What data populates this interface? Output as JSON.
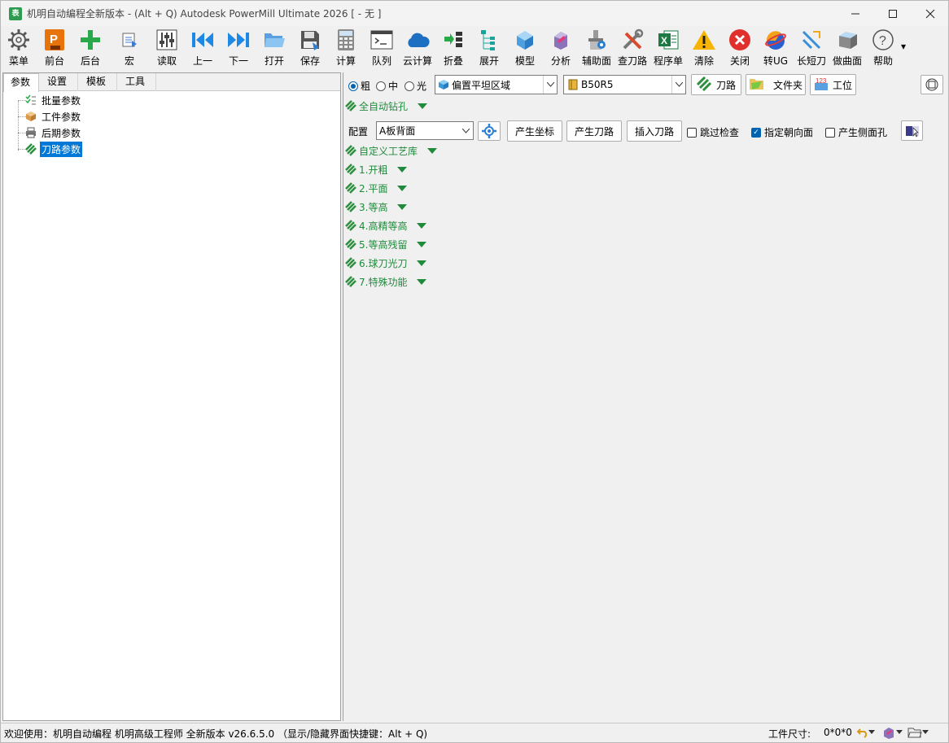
{
  "window": {
    "title": "机明自动编程全新版本 - (Alt + Q) Autodesk PowerMill Ultimate 2026   [ - 无 ]",
    "app_icon": "表",
    "controls": [
      "—",
      "☐",
      "✕"
    ]
  },
  "toolbar": {
    "items": [
      {
        "label": "菜单",
        "icon": "gear-icon"
      },
      {
        "label": "前台",
        "icon": "powermill-icon"
      },
      {
        "label": "后台",
        "icon": "plus-icon"
      },
      {
        "label": "宏",
        "icon": "macro-icon"
      },
      {
        "label": "读取",
        "icon": "sliders-icon"
      },
      {
        "label": "上一",
        "icon": "prev-icon"
      },
      {
        "label": "下一",
        "icon": "next-icon"
      },
      {
        "label": "打开",
        "icon": "folder-icon"
      },
      {
        "label": "保存",
        "icon": "save-icon"
      },
      {
        "label": "计算",
        "icon": "calculator-icon"
      },
      {
        "label": "队列",
        "icon": "terminal-icon"
      },
      {
        "label": "云计算",
        "icon": "cloud-icon"
      },
      {
        "label": "折叠",
        "icon": "collapse-icon"
      },
      {
        "label": "展开",
        "icon": "expand-icon"
      },
      {
        "label": "模型",
        "icon": "cube-icon"
      },
      {
        "label": "分析",
        "icon": "analysis-icon"
      },
      {
        "label": "辅助面",
        "icon": "aux-surface-icon"
      },
      {
        "label": "查刀路",
        "icon": "tools-icon"
      },
      {
        "label": "程序单",
        "icon": "excel-icon"
      },
      {
        "label": "清除",
        "icon": "warning-icon"
      },
      {
        "label": "关闭",
        "icon": "close-icon"
      },
      {
        "label": "转UG",
        "icon": "ug-icon"
      },
      {
        "label": "长短刀",
        "icon": "long-short-tool-icon"
      },
      {
        "label": "做曲面",
        "icon": "surface-icon"
      },
      {
        "label": "帮助",
        "icon": "help-icon"
      }
    ],
    "more_arrow": "▾"
  },
  "left_panel": {
    "tabs": [
      "参数",
      "设置",
      "模板",
      "工具"
    ],
    "active_tab": "参数",
    "tree": [
      {
        "label": "批量参数",
        "icon": "checklist-icon"
      },
      {
        "label": "工件参数",
        "icon": "box-icon"
      },
      {
        "label": "后期参数",
        "icon": "printer-icon"
      },
      {
        "label": "刀路参数",
        "icon": "toolpath-icon",
        "selected": true
      }
    ]
  },
  "right_panel": {
    "radios": [
      {
        "label": "粗",
        "checked": true
      },
      {
        "label": "中",
        "checked": false
      },
      {
        "label": "光",
        "checked": false
      }
    ],
    "strategy_combo": "偏置平坦区域",
    "tool_combo": "B50R5",
    "buttons": {
      "toolpath": "刀路",
      "folder": "文件夹",
      "workpos": "工位"
    },
    "auto_drill": "全自动钻孔",
    "config": {
      "label": "配置",
      "value": "A板背面",
      "gen_coord": "产生坐标",
      "gen_toolpath": "产生刀路",
      "insert_toolpath": "插入刀路",
      "skip_check": {
        "label": "跳过检查",
        "checked": false
      },
      "specify_face": {
        "label": "指定朝向面",
        "checked": true
      },
      "side_hole": {
        "label": "产生侧面孔",
        "checked": false
      }
    },
    "sections": [
      "自定义工艺库",
      "1.开粗",
      "2.平面",
      "3.等高",
      "4.高精等高",
      "5.等高残留",
      "6.球刀光刀",
      "7.特殊功能"
    ]
  },
  "status": {
    "welcome": "欢迎使用：机明自动编程 机明高级工程师 全新版本 v26.6.5.0 （显示/隐藏界面快捷键：Alt + Q)",
    "size_label": "工件尺寸:",
    "size_value": "0*0*0"
  },
  "colors": {
    "accent": "#0078d7",
    "section_green": "#208a3c"
  }
}
